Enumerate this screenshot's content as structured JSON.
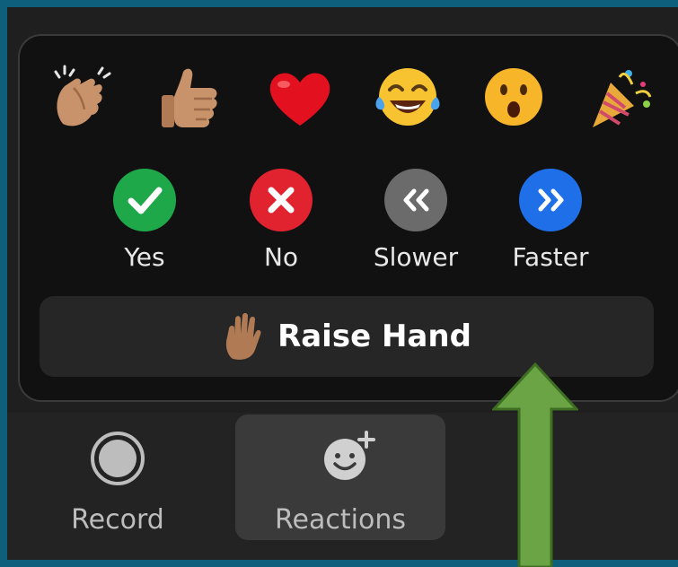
{
  "colors": {
    "background_frame": "#0d5f7c",
    "popup_bg": "#111111",
    "yes": "#1fa84a",
    "no": "#e0232f",
    "slower": "#6b6b6b",
    "faster": "#1f6fe8",
    "arrow": "#6aa444"
  },
  "emoji_reactions": [
    {
      "icon": "clapping-hands-icon"
    },
    {
      "icon": "thumbs-up-icon"
    },
    {
      "icon": "heart-icon"
    },
    {
      "icon": "tears-of-joy-icon"
    },
    {
      "icon": "surprised-face-icon"
    },
    {
      "icon": "party-popper-icon"
    }
  ],
  "feedback": {
    "yes": "Yes",
    "no": "No",
    "slower": "Slower",
    "faster": "Faster"
  },
  "raise_hand": {
    "label": "Raise Hand",
    "icon": "raised-hand-icon"
  },
  "toolbar": {
    "record_label": "Record",
    "reactions_label": "Reactions"
  }
}
